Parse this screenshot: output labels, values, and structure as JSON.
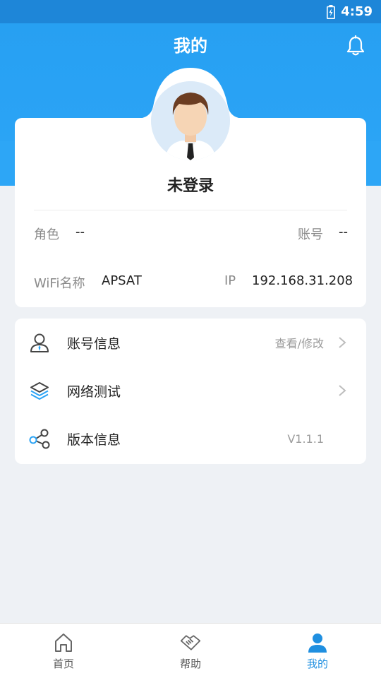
{
  "status_bar": {
    "time": "4:59"
  },
  "header": {
    "title": "我的"
  },
  "profile": {
    "name": "未登录",
    "role_label": "角色",
    "role_value": "--",
    "account_label": "账号",
    "account_value": "--",
    "wifi_label": "WiFi名称",
    "wifi_value": "APSAT",
    "ip_label": "IP",
    "ip_value": "192.168.31.208"
  },
  "menu": [
    {
      "label": "账号信息",
      "value": "查看/修改",
      "icon": "user-outline-icon"
    },
    {
      "label": "网络测试",
      "value": "",
      "icon": "layers-icon"
    },
    {
      "label": "版本信息",
      "value": "V1.1.1",
      "icon": "share-icon"
    }
  ],
  "tabs": [
    {
      "label": "首页",
      "icon": "home-icon"
    },
    {
      "label": "帮助",
      "icon": "handshake-icon"
    },
    {
      "label": "我的",
      "icon": "person-icon",
      "active": true
    }
  ],
  "colors": {
    "accent": "#2aa3f5",
    "tab_active": "#1f8fe0",
    "background": "#eef1f5"
  }
}
